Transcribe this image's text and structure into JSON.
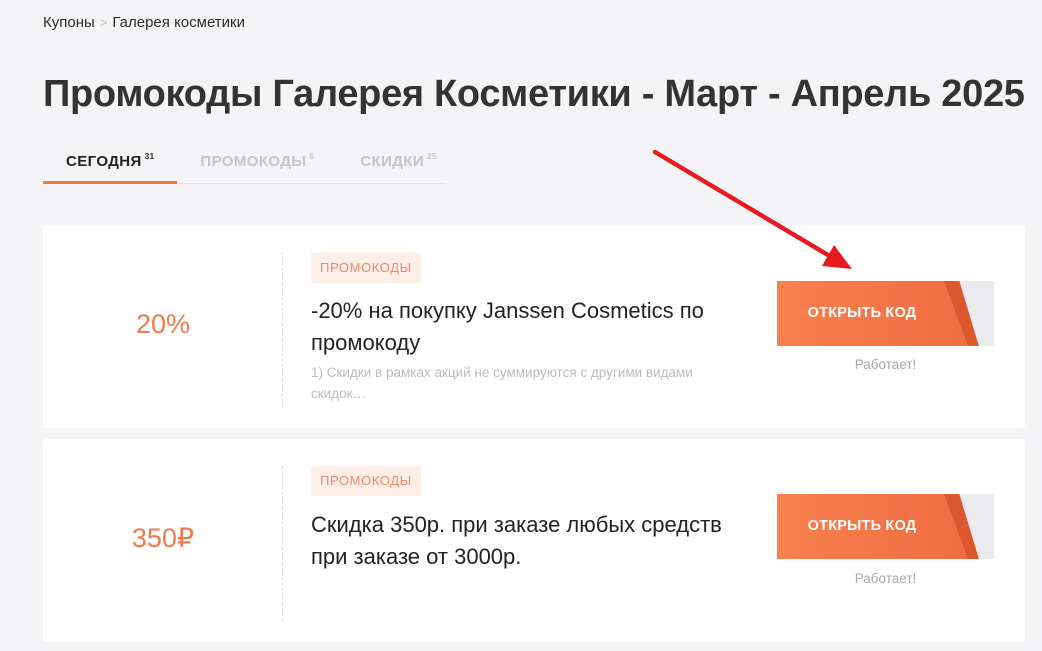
{
  "breadcrumb": {
    "root": "Купоны",
    "separator": ">",
    "current": "Галерея косметики"
  },
  "page_title": "Промокоды Галерея Косметики - Март - Апрель 2025",
  "tabs": [
    {
      "label": "СЕГОДНЯ",
      "count": "31",
      "active": true
    },
    {
      "label": "ПРОМОКОДЫ",
      "count": "6",
      "active": false
    },
    {
      "label": "СКИДКИ",
      "count": "25",
      "active": false
    }
  ],
  "coupons": [
    {
      "value": "20%",
      "tag": "ПРОМОКОДЫ",
      "title": "-20% на покупку Janssen Cosmetics по промокоду",
      "description": "1) Скидки в рамках акций не суммируются с другими видами скидок…",
      "button_label": "ОТКРЫТЬ КОД",
      "status": "Работает!"
    },
    {
      "value": "350₽",
      "tag": "ПРОМОКОДЫ",
      "title": "Скидка 350р. при заказе любых средств при заказе от 3000р.",
      "description": "",
      "button_label": "ОТКРЫТЬ КОД",
      "status": "Работает!"
    }
  ],
  "colors": {
    "accent": "#f1784a",
    "button": "#f9804f",
    "tag_background": "#fdeee8",
    "annotation_arrow": "#e8191f"
  },
  "icons": {
    "breadcrumb_separator": "chevron-right-icon",
    "annotation": "red-arrow-icon"
  }
}
